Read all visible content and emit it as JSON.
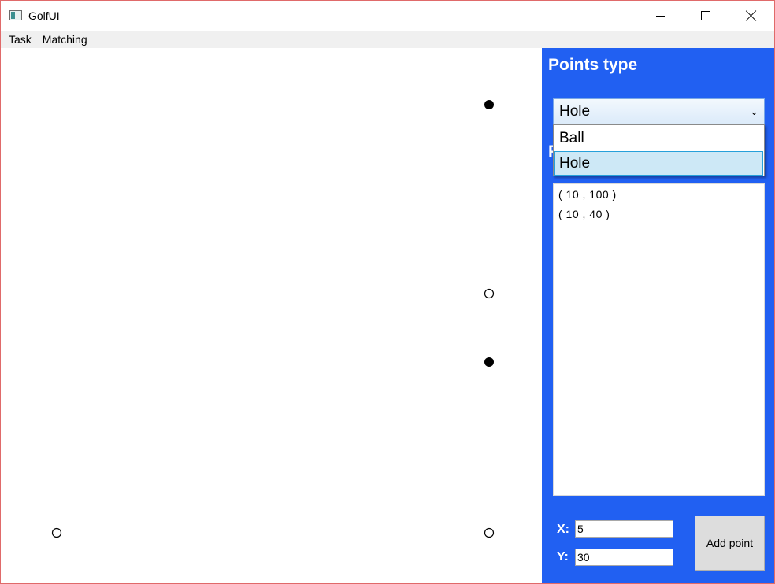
{
  "window": {
    "title": "GolfUI",
    "icon": "app-window-icon"
  },
  "menu": {
    "items": [
      "Task",
      "Matching"
    ]
  },
  "canvas": {
    "points": [
      {
        "kind": "ball",
        "style": "filled"
      },
      {
        "kind": "hole",
        "style": "hollow"
      },
      {
        "kind": "ball",
        "style": "filled"
      },
      {
        "kind": "hole",
        "style": "hollow"
      },
      {
        "kind": "hole",
        "style": "hollow"
      }
    ]
  },
  "panel": {
    "title": "Points type",
    "hidden_heading": "P",
    "points_type": {
      "selected": "Hole",
      "options": [
        "Ball",
        "Hole"
      ],
      "expanded": true
    },
    "list": {
      "rows": [
        "( 10 ,  100 )",
        "( 10 ,  40 )"
      ]
    },
    "x_label": "X:",
    "y_label": "Y:",
    "x_value": "5",
    "y_value": "30",
    "add_button_label": "Add point"
  },
  "colors": {
    "panel_bg": "#2160f2",
    "window_border": "#e06a6a",
    "menubar_bg": "#f0f0f0",
    "dropdown_highlight": "#cde8f6"
  }
}
